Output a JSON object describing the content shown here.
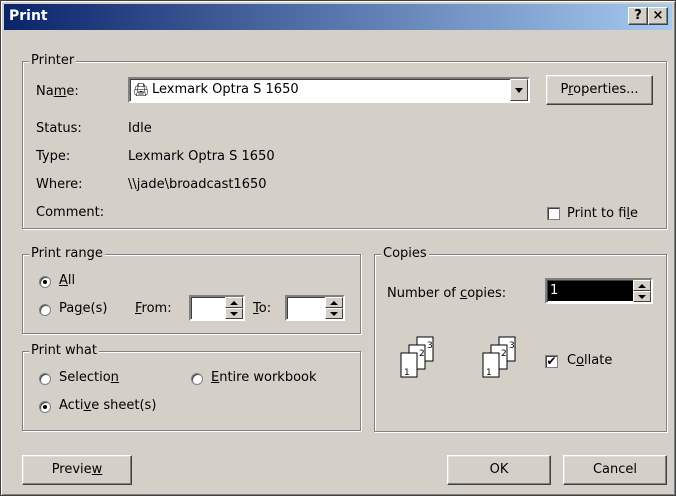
{
  "window": {
    "title": "Print",
    "help_btn": "?",
    "close_btn": "×"
  },
  "printer": {
    "group_label": "Printer",
    "name_label": "Name:",
    "name_value": "Lexmark Optra S 1650",
    "properties_btn": "Properties...",
    "status_label": "Status:",
    "status_value": "Idle",
    "type_label": "Type:",
    "type_value": "Lexmark Optra S 1650",
    "where_label": "Where:",
    "where_value": "\\\\jade\\broadcast1650",
    "comment_label": "Comment:",
    "comment_value": "",
    "print_to_file": {
      "label": "Print to file",
      "checked": false
    }
  },
  "print_range": {
    "group_label": "Print range",
    "all_label": "All",
    "all_selected": true,
    "pages_label": "Page(s)",
    "pages_selected": false,
    "from_label": "From:",
    "from_value": "",
    "to_label": "To:",
    "to_value": ""
  },
  "print_what": {
    "group_label": "Print what",
    "selection_label": "Selection",
    "selection_selected": false,
    "entire_label": "Entire workbook",
    "entire_selected": false,
    "active_label": "Active sheet(s)",
    "active_selected": true
  },
  "copies": {
    "group_label": "Copies",
    "number_label": "Number of copies:",
    "number_value": "1",
    "collate_label": "Collate",
    "collate_checked": true,
    "collate_icon_pages": [
      "1",
      "2",
      "3"
    ]
  },
  "buttons": {
    "preview": "Preview",
    "ok": "OK",
    "cancel": "Cancel"
  },
  "colors": {
    "title_bar_start": "#0a246a",
    "title_bar_end": "#a6caf0",
    "face": "#d4d0c8"
  }
}
